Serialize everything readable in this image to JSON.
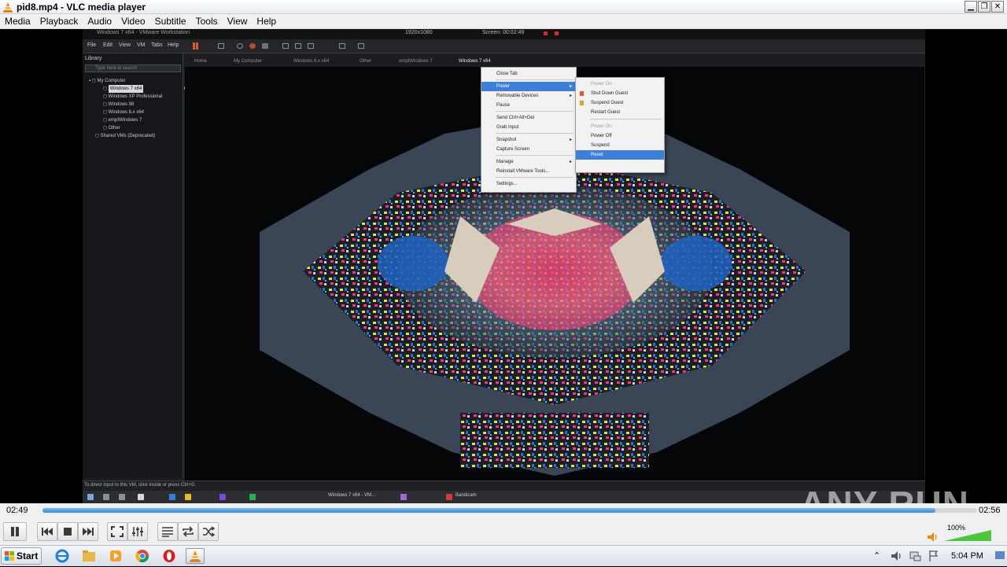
{
  "window": {
    "title": "pid8.mp4 - VLC media player",
    "buttons": [
      "minimize",
      "restore",
      "close"
    ]
  },
  "menubar": {
    "items": [
      "Media",
      "Playback",
      "Audio",
      "Video",
      "Subtitle",
      "Tools",
      "View",
      "Help"
    ]
  },
  "video_content": {
    "vmware_title": "Windows 7 x64 - VMware Workstation",
    "vmware_toolbar_resolution": "1920x1080",
    "vmware_toolbar_timer": "Screen: 00:02:49",
    "vmware_menu": [
      "File",
      "Edit",
      "View",
      "VM",
      "Tabs",
      "Help"
    ],
    "library_label": "Library",
    "library_search_placeholder": "Type here to search",
    "library_tree": [
      {
        "label": "My Computer",
        "level": 0
      },
      {
        "label": "Windows 7 x64",
        "level": 1,
        "selected": true
      },
      {
        "label": "Windows XP Professional",
        "level": 1
      },
      {
        "label": "Windows 98",
        "level": 1
      },
      {
        "label": "Windows 8.x x64",
        "level": 1
      },
      {
        "label": "empIWindows 7",
        "level": 1
      },
      {
        "label": "Other",
        "level": 1
      },
      {
        "label": "Shared VMs (Deprecated)",
        "level": 0
      }
    ],
    "vm_tabs": [
      "Home",
      "My Computer",
      "Windows 8.x x64",
      "Other",
      "emptWindows 7",
      "Windows 7 x64"
    ],
    "context_menu": [
      {
        "label": "Close Tab"
      },
      {
        "label": "Power",
        "submenu": true,
        "highlighted": true
      },
      {
        "label": "Removable Devices",
        "submenu": true
      },
      {
        "label": "Pause"
      },
      {
        "label": "Send Ctrl+Alt+Del"
      },
      {
        "label": "Grab Input"
      },
      {
        "label": "Snapshot",
        "submenu": true
      },
      {
        "label": "Capture Screen"
      },
      {
        "label": "Manage",
        "submenu": true
      },
      {
        "label": "Reinstall VMware Tools..."
      },
      {
        "label": "Settings..."
      }
    ],
    "power_submenu": [
      {
        "label": "Power On",
        "dim": true
      },
      {
        "label": "Shut Down Guest"
      },
      {
        "label": "Suspend Guest"
      },
      {
        "label": "Restart Guest"
      },
      {
        "label": "Power On",
        "dim": true
      },
      {
        "label": "Power Off"
      },
      {
        "label": "Suspend"
      },
      {
        "label": "Reset",
        "highlighted": true
      }
    ],
    "status_text": "To direct input to this VM, click inside or press Ctrl+G.",
    "guest_taskbar_window": "Windows 7 x64 - VM...",
    "guest_taskbar_app": "Bandicam",
    "watermark": "ANY RUN"
  },
  "playback": {
    "elapsed": "02:49",
    "total": "02:56",
    "progress_fraction": 0.955,
    "volume_percent": "100%"
  },
  "controls": {
    "buttons": [
      "pause-icon",
      "previous-icon",
      "stop-icon",
      "next-icon",
      "fullscreen-icon",
      "extended-settings-icon",
      "playlist-icon",
      "loop-icon",
      "shuffle-icon"
    ]
  },
  "taskbar": {
    "start_label": "Start",
    "pinned": [
      "ie-icon",
      "explorer-icon",
      "media-player-icon",
      "chrome-icon",
      "opera-icon",
      "vlc-icon"
    ],
    "clock": "5:04 PM"
  },
  "colors": {
    "accent": "#3c8ad8",
    "vlc_orange": "#f28a00",
    "highlight": "#3d7fd9"
  }
}
